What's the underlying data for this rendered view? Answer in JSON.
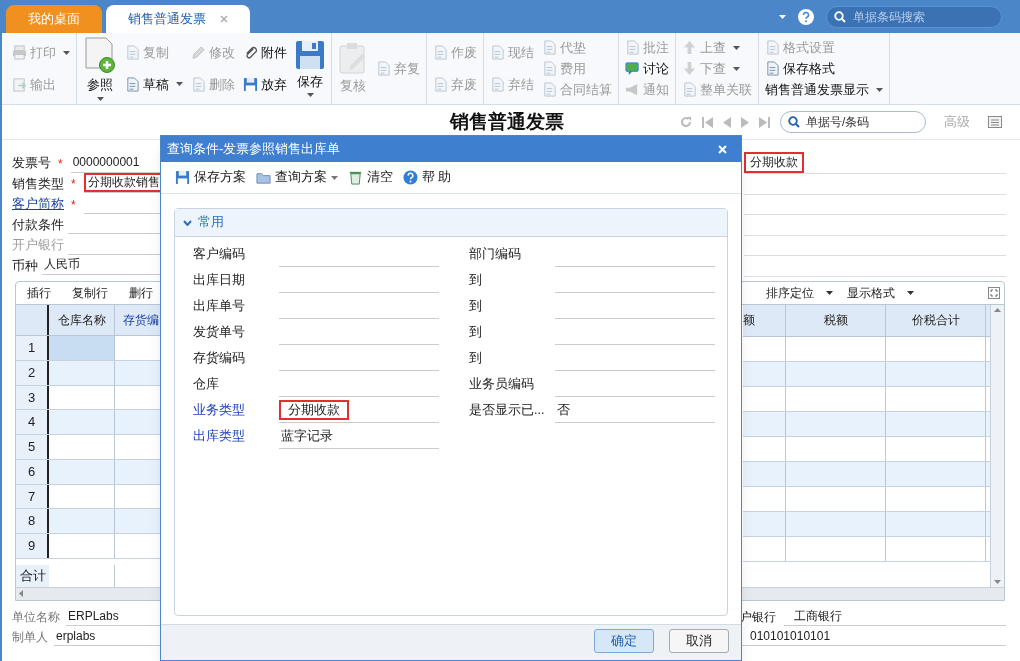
{
  "tabs": [
    {
      "label": "我的桌面",
      "selected": false,
      "closable": false
    },
    {
      "label": "销售普通发票",
      "selected": true,
      "closable": true
    }
  ],
  "top_search": {
    "placeholder": "单据条码搜索"
  },
  "toolbar": {
    "groups": [
      {
        "columns": [
          [
            {
              "label": "打印",
              "kind": "printer",
              "disabled": true,
              "caret": true
            },
            {
              "label": "输出",
              "kind": "export",
              "disabled": true,
              "caret": false
            }
          ]
        ]
      },
      {
        "columns": [
          [
            {
              "label": "参照",
              "kind": "add",
              "disabled": false,
              "caret": true
            }
          ],
          [
            {
              "label": "复制",
              "kind": "document",
              "disabled": true,
              "caret": false
            },
            {
              "label": "草稿",
              "kind": "document",
              "disabled": false,
              "caret": true
            }
          ],
          [
            {
              "label": "修改",
              "kind": "pencil",
              "disabled": true,
              "caret": false
            },
            {
              "label": "删除",
              "kind": "document",
              "disabled": true,
              "caret": false
            }
          ],
          [
            {
              "label": "附件",
              "kind": "clip",
              "disabled": false,
              "caret": false
            },
            {
              "label": "放弃",
              "kind": "floppy",
              "disabled": false,
              "caret": false
            }
          ],
          [
            {
              "label": "保存",
              "kind": "save",
              "disabled": false,
              "caret": true
            }
          ]
        ]
      },
      {
        "columns": [
          [
            {
              "label": "复核",
              "kind": "review",
              "disabled": true,
              "caret": false
            }
          ],
          [
            {
              "label": "弃复",
              "kind": "document",
              "disabled": true,
              "caret": false
            }
          ]
        ]
      },
      {
        "columns": [
          [
            {
              "label": "作废",
              "kind": "document",
              "disabled": true,
              "caret": false
            },
            {
              "label": "弃废",
              "kind": "document",
              "disabled": true,
              "caret": false
            }
          ]
        ]
      },
      {
        "columns": [
          [
            {
              "label": "现结",
              "kind": "document",
              "disabled": true,
              "caret": false
            },
            {
              "label": "弃结",
              "kind": "document",
              "disabled": true,
              "caret": false
            }
          ],
          [
            {
              "label": "代垫",
              "kind": "document",
              "disabled": true,
              "caret": false
            },
            {
              "label": "费用",
              "kind": "document",
              "disabled": true,
              "caret": false
            },
            {
              "label": "合同结算",
              "kind": "document",
              "disabled": true,
              "caret": false
            }
          ]
        ]
      },
      {
        "columns": [
          [
            {
              "label": "批注",
              "kind": "document",
              "disabled": true,
              "caret": false
            },
            {
              "label": "讨论",
              "kind": "chat",
              "disabled": false,
              "caret": false
            },
            {
              "label": "通知",
              "kind": "notice",
              "disabled": true,
              "caret": false
            }
          ]
        ]
      },
      {
        "columns": [
          [
            {
              "label": "上查",
              "kind": "up",
              "disabled": true,
              "caret": true
            },
            {
              "label": "下查",
              "kind": "down",
              "disabled": true,
              "caret": true
            },
            {
              "label": "整单关联",
              "kind": "document",
              "disabled": true,
              "caret": false
            }
          ]
        ]
      },
      {
        "columns": [
          [
            {
              "label": "格式设置",
              "kind": "document",
              "disabled": true,
              "caret": false
            },
            {
              "label": "保存格式",
              "kind": "document",
              "disabled": false,
              "caret": false
            },
            {
              "label": "销售普通发票显示",
              "kind": "text",
              "disabled": false,
              "caret": true
            }
          ]
        ]
      }
    ]
  },
  "title": "销售普通发票",
  "record_search": {
    "placeholder": "单据号/条码"
  },
  "advanced_link": "高级",
  "header_fields": [
    {
      "label": "发票号",
      "marker": "*",
      "linked": false,
      "disabled": false,
      "value": "0000000001",
      "highlighted": false
    },
    {
      "label": "销售类型",
      "marker": "*",
      "linked": false,
      "disabled": false,
      "value": "分期收款销售",
      "highlighted": true
    },
    {
      "label": "客户简称",
      "marker": "*",
      "linked": true,
      "disabled": false
    },
    {
      "label": "付款条件",
      "linked": false,
      "disabled": false
    },
    {
      "label": "开户银行",
      "linked": false,
      "disabled": true
    },
    {
      "label": "币种",
      "linked": false,
      "disabled": false,
      "value": "人民币",
      "highlighted": false
    }
  ],
  "header_right_values": [
    {
      "value": "分期收款",
      "highlighted": true
    }
  ],
  "grid": {
    "left_actions": [
      "插行",
      "复制行",
      "删行"
    ],
    "right_actions": [
      "排序定位",
      "显示格式"
    ],
    "left_columns": [
      "仓库名称",
      "存货编"
    ],
    "right_columns": [
      "额",
      "税额",
      "价税合计"
    ],
    "rows": [
      {
        "number": "1",
        "selected": true
      },
      {
        "number": "2",
        "selected": false
      },
      {
        "number": "3",
        "selected": false
      },
      {
        "number": "4",
        "selected": false
      },
      {
        "number": "5",
        "selected": false
      },
      {
        "number": "6",
        "selected": false
      },
      {
        "number": "7",
        "selected": false
      },
      {
        "number": "8",
        "selected": false
      },
      {
        "number": "9",
        "selected": false
      }
    ],
    "total_label": "合计"
  },
  "footer_left": [
    {
      "label": "单位名称",
      "value": "ERPLabs"
    },
    {
      "label": "制单人",
      "value": "erplabs"
    }
  ],
  "footer_right": [
    {
      "label": "户银行",
      "value": "工商银行"
    },
    {
      "value": "010101010101"
    }
  ],
  "dialog": {
    "title": "查询条件-发票参照销售出库单",
    "actions": [
      {
        "label": "保存方案",
        "kind": "floppy",
        "caret": false
      },
      {
        "label": "查询方案",
        "kind": "folder",
        "caret": true
      },
      {
        "label": "清空",
        "kind": "trash",
        "caret": false
      },
      {
        "label": "帮 助",
        "kind": "help",
        "caret": false
      }
    ],
    "section": {
      "title": "常用",
      "expanded": true
    },
    "rows": [
      [
        {
          "label": "客户编码",
          "linked": false
        },
        {
          "label": "部门编码",
          "linked": false
        }
      ],
      [
        {
          "label": "出库日期",
          "linked": false
        },
        {
          "label": "到",
          "linked": false
        }
      ],
      [
        {
          "label": "出库单号",
          "linked": false
        },
        {
          "label": "到",
          "linked": false
        }
      ],
      [
        {
          "label": "发货单号",
          "linked": false
        },
        {
          "label": "到",
          "linked": false
        }
      ],
      [
        {
          "label": "存货编码",
          "linked": false
        },
        {
          "label": "到",
          "linked": false
        }
      ],
      [
        {
          "label": "仓库",
          "linked": false
        },
        {
          "label": "业务员编码",
          "linked": false
        }
      ],
      [
        {
          "label": "业务类型",
          "linked": true,
          "value": "分期收款",
          "highlighted": true
        },
        {
          "label": "是否显示已...",
          "linked": false,
          "value": "否",
          "highlighted": false
        }
      ],
      [
        {
          "label": "出库类型",
          "linked": true,
          "value": "蓝字记录",
          "highlighted": false
        }
      ]
    ],
    "buttons": [
      {
        "label": "确定",
        "primary": true
      },
      {
        "label": "取消",
        "primary": false
      }
    ]
  }
}
